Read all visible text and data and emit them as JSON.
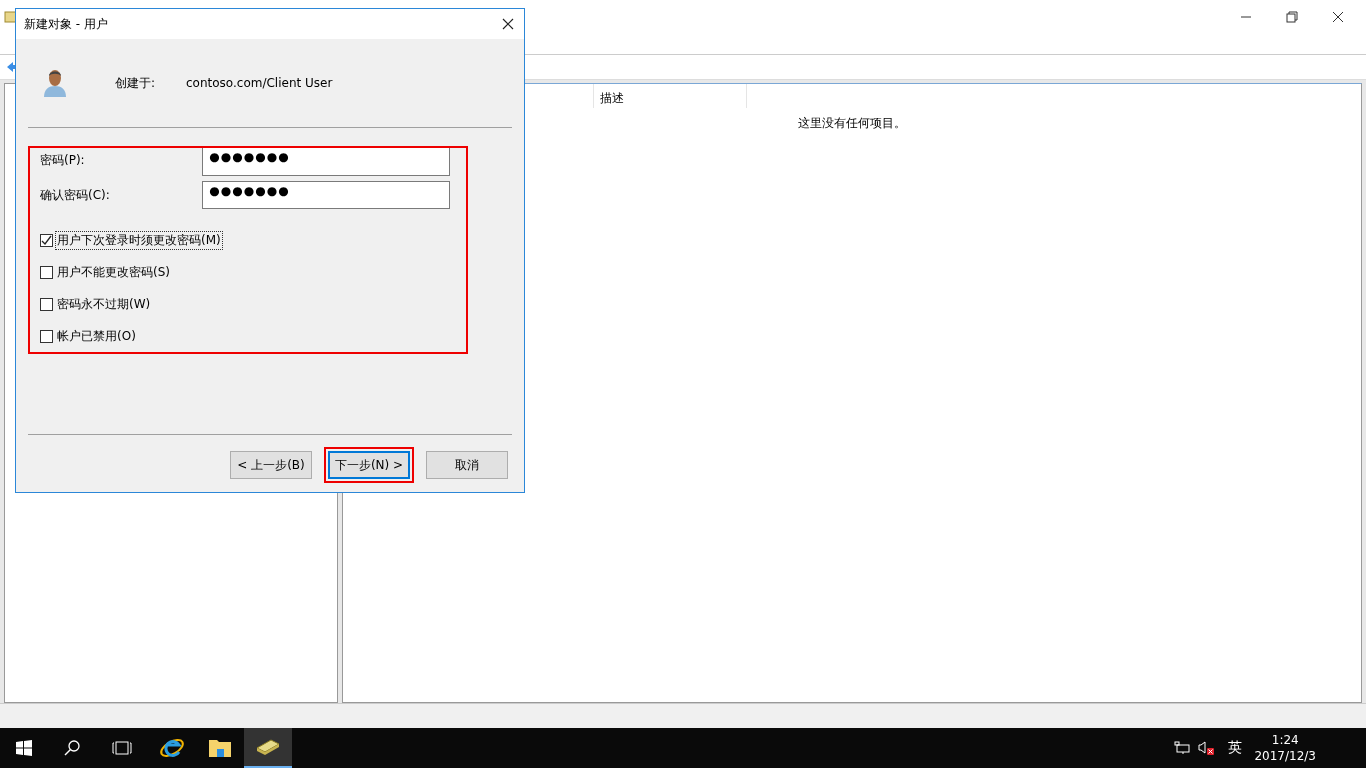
{
  "main_window": {
    "list_columns": [
      "描述"
    ],
    "empty_message": "这里没有任何项目。"
  },
  "dialog": {
    "title": "新建对象 - 用户",
    "created_in_label": "创建于:",
    "created_in_value": "contoso.com/Client User",
    "fields": [
      {
        "label": "密码(P):",
        "value": "●●●●●●●"
      },
      {
        "label": "确认密码(C):",
        "value": "●●●●●●●"
      }
    ],
    "checkboxes": [
      {
        "label": "用户下次登录时须更改密码(M)",
        "checked": true,
        "focused": true
      },
      {
        "label": "用户不能更改密码(S)",
        "checked": false,
        "focused": false
      },
      {
        "label": "密码永不过期(W)",
        "checked": false,
        "focused": false
      },
      {
        "label": "帐户已禁用(O)",
        "checked": false,
        "focused": false
      }
    ],
    "buttons": [
      {
        "label": "< 上一步(B)",
        "default": false,
        "highlighted": false
      },
      {
        "label": "下一步(N) >",
        "default": true,
        "highlighted": true
      },
      {
        "label": "取消",
        "default": false,
        "highlighted": false
      }
    ]
  },
  "taskbar": {
    "apps": [
      {
        "kind": "ie",
        "selected": false
      },
      {
        "kind": "explorer",
        "selected": false
      },
      {
        "kind": "aduc",
        "selected": true
      }
    ],
    "input_language": "英",
    "time": "1:24",
    "date": "2017/12/3"
  }
}
